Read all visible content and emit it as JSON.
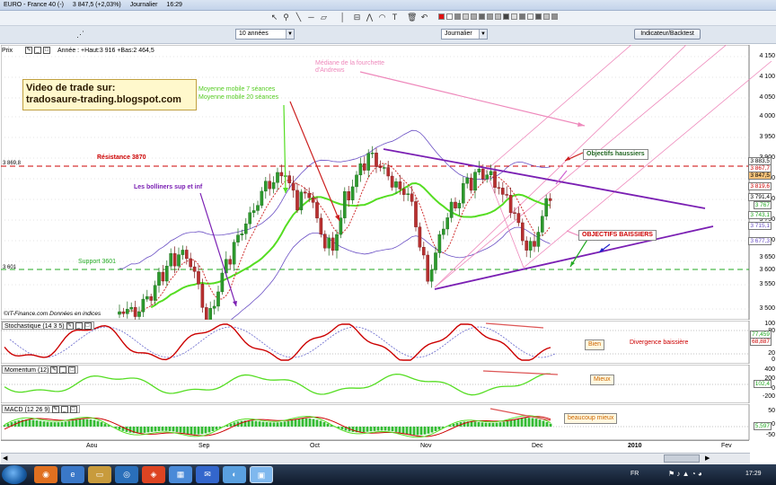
{
  "titlebar": {
    "instrument": "EURO - France 40 (-)",
    "price_change": "3 847,5 (+2,03%)",
    "period": "Journalier",
    "time": "16:29"
  },
  "toolbar": {
    "period_select": "10 années",
    "interval_select": "Journalier",
    "indicator_button": "Indicateur/Backtest"
  },
  "price_panel": {
    "header": "Prix",
    "info": "Année : +Haut:3 916 +Bas:2 464,5",
    "copyright": "©IT-Finance.com  Données en indices",
    "y_ticks": [
      "4 150",
      "4 100",
      "4 050",
      "4 000",
      "3 950",
      "3 900",
      "3 850",
      "3 800",
      "3 750",
      "3 700",
      "3 650",
      "3 600",
      "3 550",
      "3 500"
    ],
    "price_boxes": [
      "3 883,5",
      "3 867,7",
      "3 847,5",
      "3 819,6",
      "3 791,4",
      "3 767",
      "3 743,1",
      "3 715,1",
      "3 677,3"
    ],
    "level_left_labels": [
      "3 869,8",
      "3 601"
    ]
  },
  "annotations": {
    "video_line1": "Video de trade sur:",
    "video_line2": "tradosaure-trading.blogspot.com",
    "mm7": "Moyenne mobile 7 séances",
    "mm20": "Moyenne mobile 20 séances",
    "resistance": "Résistance 3870",
    "mediane1": "Médiane de la fourchette",
    "mediane2": "d'Andrews",
    "bollinger": "Les bolliners sup et inf",
    "support": "Support 3601",
    "objectifs_haussiers": "Objectifs haussiers",
    "objectifs_baissiers": "OBJECTIFS BAISSIERS",
    "bien": "Bien",
    "divergence": "Divergence baissière",
    "mieux": "Mieux",
    "beaucoup_mieux": "beaucoup mieux"
  },
  "stochastic_panel": {
    "header": "Stochastique (14 3 5)",
    "y_ticks": [
      "100",
      "80",
      "20",
      "0"
    ],
    "value_boxes": [
      "77,459",
      "68,887"
    ]
  },
  "momentum_panel": {
    "header": "Momentum (12)",
    "y_ticks": [
      "400",
      "200",
      "0",
      "-200"
    ],
    "value_box": "102,4"
  },
  "macd_panel": {
    "header": "MACD (12 26 9)",
    "y_ticks": [
      "50",
      "0",
      "-50"
    ],
    "value_box": "5,597"
  },
  "x_axis": [
    "Aou",
    "Sep",
    "Oct",
    "Nov",
    "Dec",
    "2010",
    "Fev"
  ],
  "taskbar": {
    "lang": "FR",
    "clock": "17:29"
  },
  "colors": {
    "resistance": "#cc0000",
    "support": "#22aa22",
    "triangle": "#7a1fb3",
    "andrews": "#ee88bb",
    "bollinger": "#6a4fc4",
    "mm7": "#d03030",
    "mm20": "#55dd22",
    "video_box": "#fff8cc"
  }
}
